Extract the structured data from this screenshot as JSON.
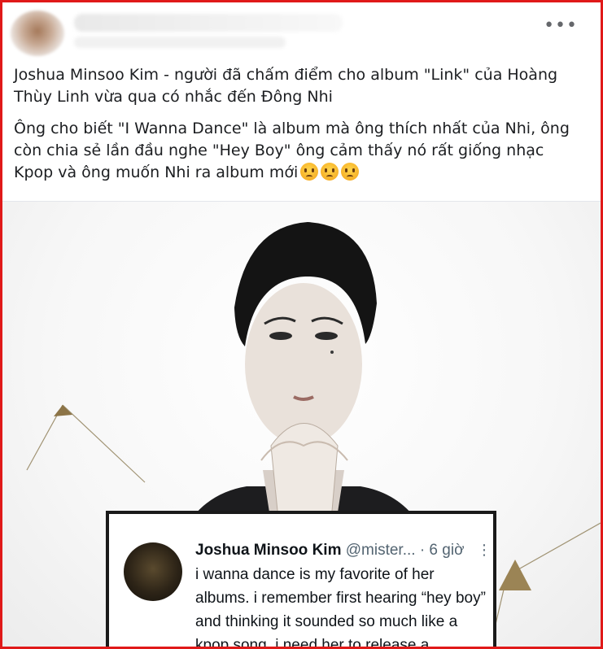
{
  "post": {
    "more_label": "•••",
    "paragraph1": "Joshua Minsoo Kim - người đã chấm điểm cho album \"Link\" của Hoàng Thùy Linh vừa qua có nhắc đến Đông Nhi",
    "paragraph2": "Ông cho biết \"I Wanna Dance\" là album mà ông thích nhất của Nhi, ông còn chia sẻ lần đầu nghe \"Hey Boy\" ông cảm thấy nó rất giống nhạc Kpop và ông muốn Nhi ra album mới",
    "emoji_count": 3
  },
  "tweet": {
    "author": "Joshua Minsoo Kim",
    "handle": "@mister...",
    "time": "· 6 giờ",
    "more": "⋮",
    "text": "i wanna dance is my favorite of her albums. i remember first hearing “hey boy” and thinking it sounded so much like a kpop song. i need her to release a"
  },
  "colors": {
    "frame_border": "#e01919",
    "text": "#1c1e21",
    "muted": "#65676b"
  }
}
